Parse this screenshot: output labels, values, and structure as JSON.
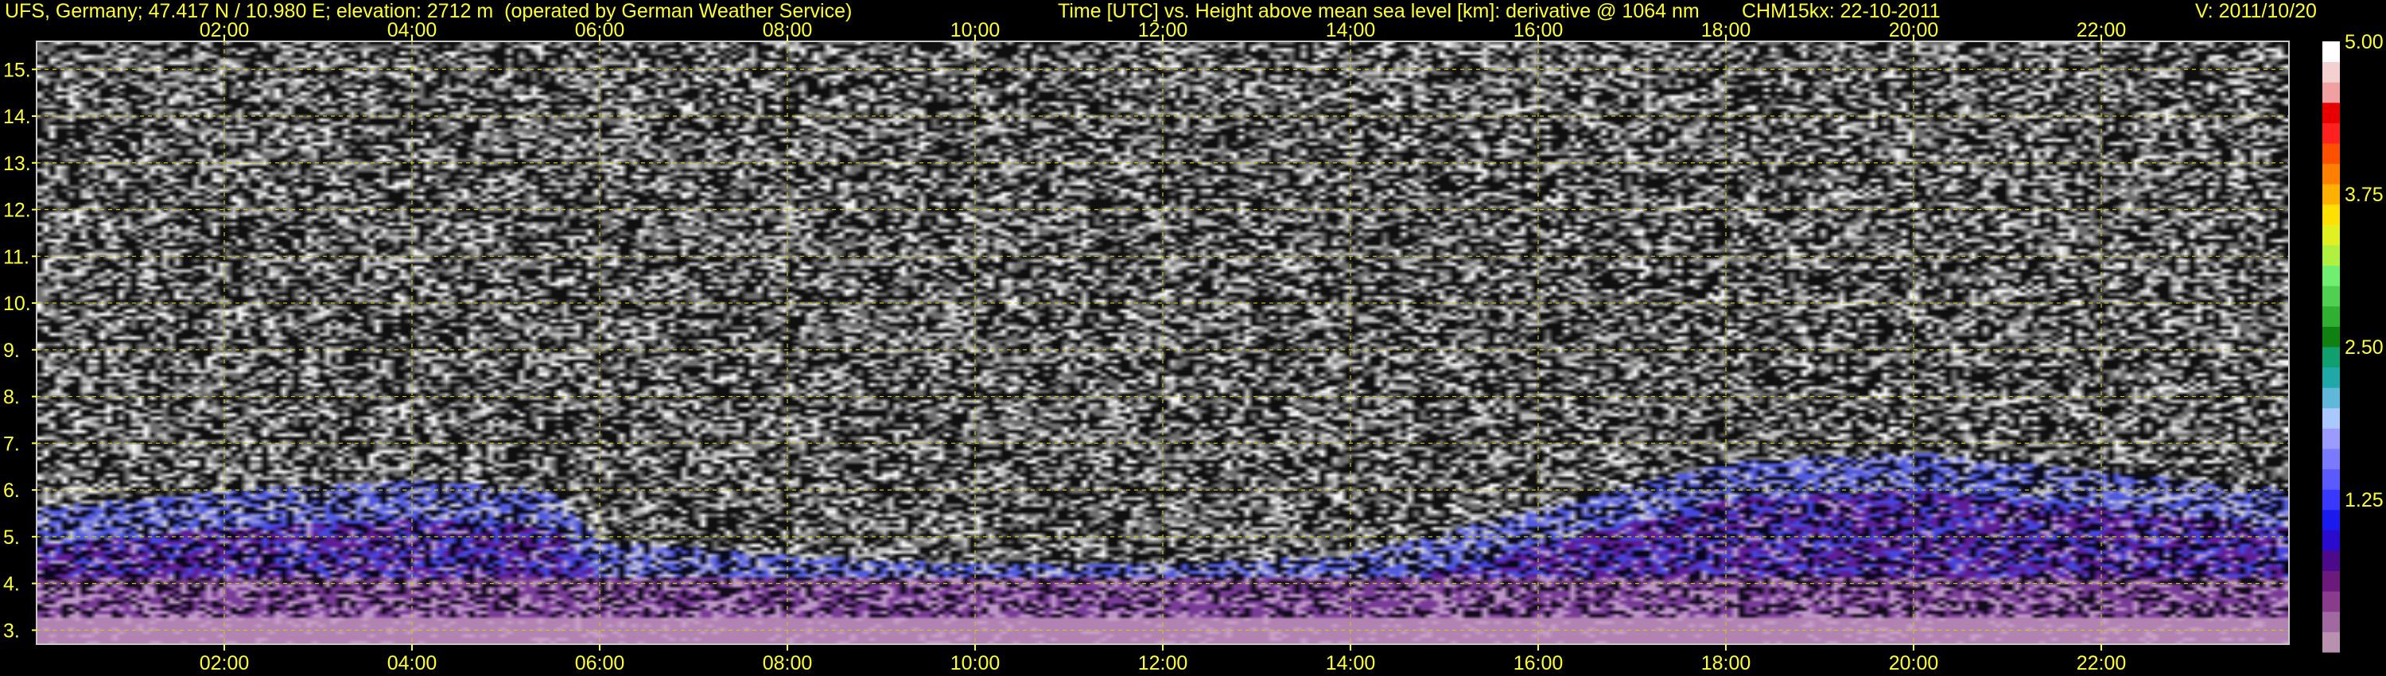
{
  "header": {
    "site": "UFS, Germany; 47.417 N / 10.980 E; elevation: 2712 m  (operated by German Weather Service)",
    "description": "Time [UTC] vs. Height above mean sea level [km]: derivative @ 1064 nm",
    "instrument_date": "CHM15kx: 22-10-2011",
    "version": "V: 2011/10/20"
  },
  "chart_data": {
    "type": "heatmap",
    "title": "",
    "xlabel": "Time [UTC]",
    "ylabel": "Height above mean sea level [km]",
    "x_range": [
      "00:00",
      "24:00"
    ],
    "y_range": [
      2.7,
      15.6
    ],
    "x_ticks": [
      "02:00",
      "04:00",
      "06:00",
      "08:00",
      "10:00",
      "12:00",
      "14:00",
      "16:00",
      "18:00",
      "20:00",
      "22:00"
    ],
    "y_ticks": [
      "3.",
      "4.",
      "5.",
      "6.",
      "7.",
      "8.",
      "9.",
      "10.",
      "11.",
      "12.",
      "13.",
      "14.",
      "15."
    ],
    "grid": true,
    "colorbar": {
      "range": [
        0,
        5
      ],
      "tick_labels": [
        "1.25",
        "2.50",
        "3.75",
        "5.00"
      ],
      "colors": [
        "#b890b0",
        "#a06aa0",
        "#8a3c8c",
        "#6a1a7a",
        "#4a0a8a",
        "#2a0acc",
        "#1a1aee",
        "#3838ff",
        "#5a5aff",
        "#7a7aff",
        "#9a9aff",
        "#a8c8ff",
        "#60b8d8",
        "#20a8a8",
        "#10a070",
        "#108010",
        "#30b030",
        "#50d050",
        "#70ee70",
        "#b0f040",
        "#e0f020",
        "#ffe000",
        "#ffb000",
        "#ff8000",
        "#ff5000",
        "#ff2020",
        "#e80000",
        "#f0a0a0",
        "#f4d0d0",
        "#ffffff"
      ]
    },
    "aerosol_layer_top_km": [
      {
        "time": "00:00",
        "height": 5.6
      },
      {
        "time": "02:00",
        "height": 6.0
      },
      {
        "time": "04:00",
        "height": 6.2
      },
      {
        "time": "05:30",
        "height": 6.0
      },
      {
        "time": "06:00",
        "height": 4.9
      },
      {
        "time": "08:00",
        "height": 4.6
      },
      {
        "time": "10:00",
        "height": 4.4
      },
      {
        "time": "12:00",
        "height": 4.4
      },
      {
        "time": "14:00",
        "height": 4.6
      },
      {
        "time": "16:00",
        "height": 5.6
      },
      {
        "time": "18:00",
        "height": 6.6
      },
      {
        "time": "20:00",
        "height": 6.8
      },
      {
        "time": "22:00",
        "height": 6.4
      },
      {
        "time": "24:00",
        "height": 6.0
      }
    ]
  }
}
